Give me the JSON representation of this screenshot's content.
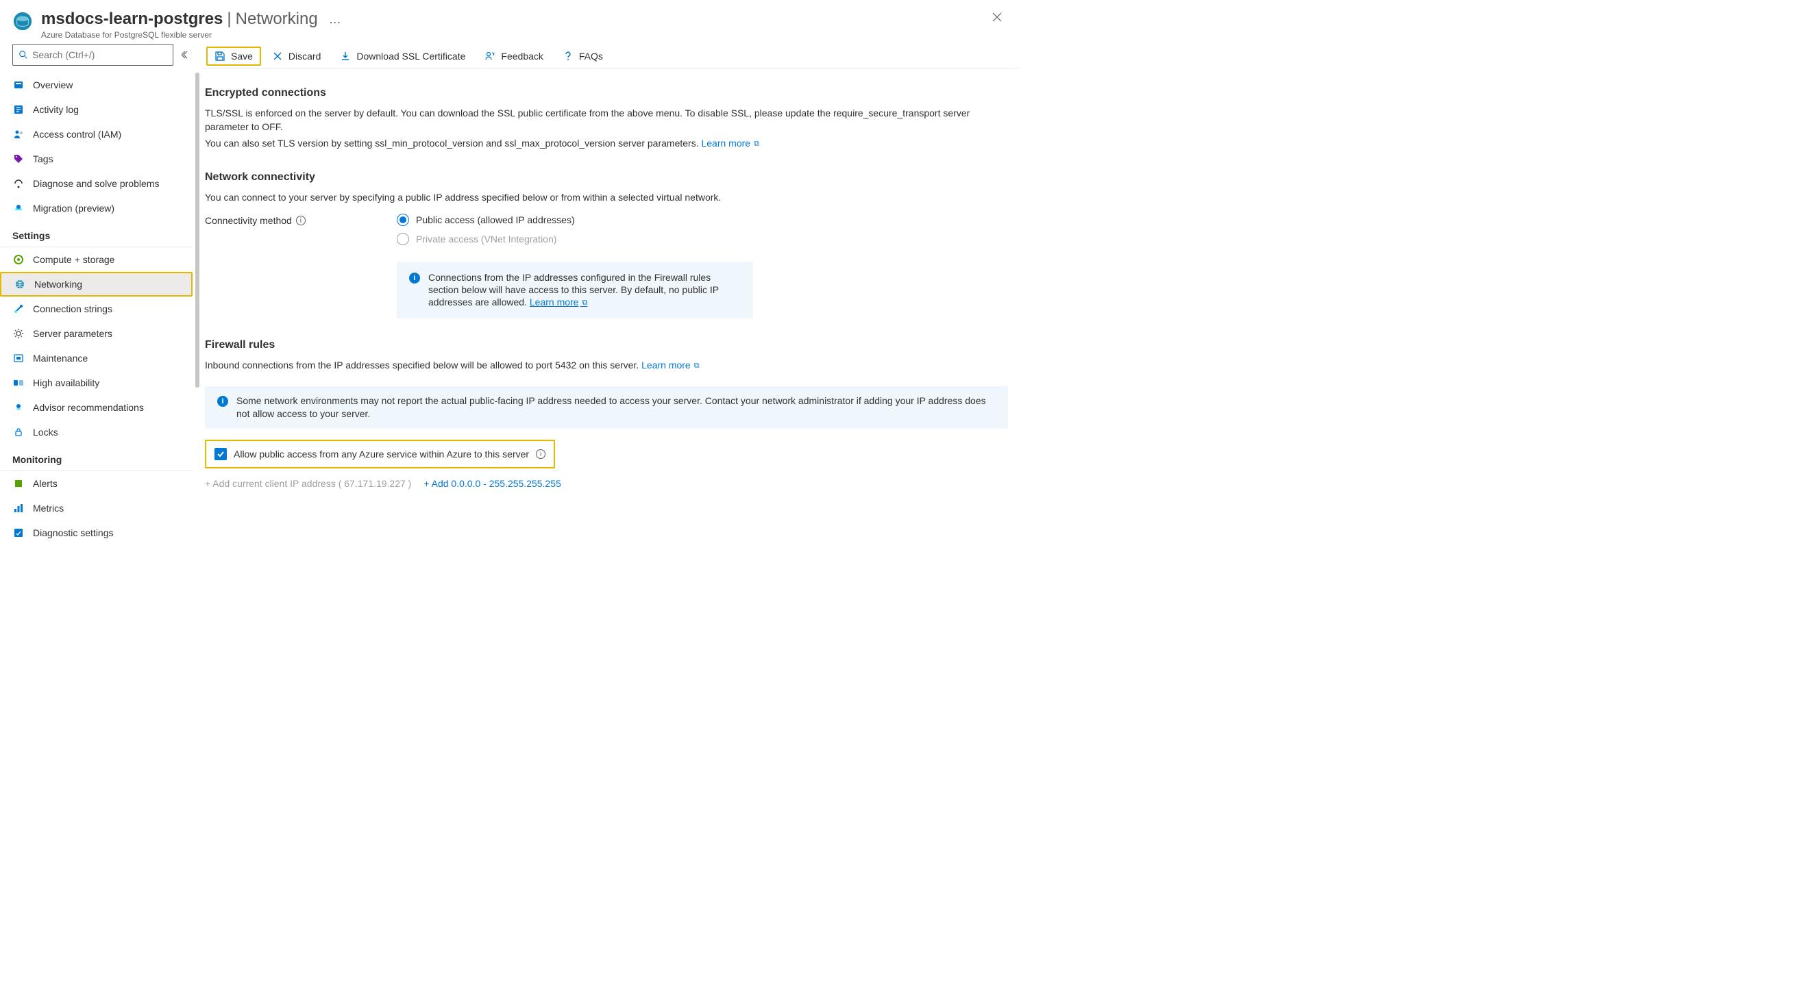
{
  "header": {
    "title": "msdocs-learn-postgres",
    "blade": "Networking",
    "more": "…",
    "subtitle": "Azure Database for PostgreSQL flexible server"
  },
  "search": {
    "placeholder": "Search (Ctrl+/)"
  },
  "sidebar": {
    "top": [
      {
        "label": "Overview"
      },
      {
        "label": "Activity log"
      },
      {
        "label": "Access control (IAM)"
      },
      {
        "label": "Tags"
      },
      {
        "label": "Diagnose and solve problems"
      },
      {
        "label": "Migration (preview)"
      }
    ],
    "settings_header": "Settings",
    "settings": [
      {
        "label": "Compute + storage"
      },
      {
        "label": "Networking"
      },
      {
        "label": "Connection strings"
      },
      {
        "label": "Server parameters"
      },
      {
        "label": "Maintenance"
      },
      {
        "label": "High availability"
      },
      {
        "label": "Advisor recommendations"
      },
      {
        "label": "Locks"
      }
    ],
    "monitoring_header": "Monitoring",
    "monitoring": [
      {
        "label": "Alerts"
      },
      {
        "label": "Metrics"
      },
      {
        "label": "Diagnostic settings"
      }
    ]
  },
  "toolbar": {
    "save": "Save",
    "discard": "Discard",
    "download": "Download SSL Certificate",
    "feedback": "Feedback",
    "faqs": "FAQs"
  },
  "encrypted": {
    "heading": "Encrypted connections",
    "p1": "TLS/SSL is enforced on the server by default. You can download the SSL public certificate from the above menu. To disable SSL, please update the require_secure_transport server parameter to OFF.",
    "p2": "You can also set TLS version by setting ssl_min_protocol_version and ssl_max_protocol_version server parameters.",
    "learn": "Learn more"
  },
  "network": {
    "heading": "Network connectivity",
    "p1": "You can connect to your server by specifying a public IP address specified below or from within a selected virtual network.",
    "label": "Connectivity method",
    "opt1": "Public access (allowed IP addresses)",
    "opt2": "Private access (VNet Integration)",
    "info": "Connections from the IP addresses configured in the Firewall rules section below will have access to this server. By default, no public IP addresses are allowed.",
    "info_learn": "Learn more"
  },
  "firewall": {
    "heading": "Firewall rules",
    "p1": "Inbound connections from the IP addresses specified below will be allowed to port 5432 on this server.",
    "learn": "Learn more",
    "warn": "Some network environments may not report the actual public-facing IP address needed to access your server.  Contact your network administrator if adding your IP address does not allow access to your server.",
    "checkbox_label": "Allow public access from any Azure service within Azure to this server",
    "add_current_prefix": "+ Add current client IP address",
    "add_current_ip": "( 67.171.19.227 )",
    "add_range": "+ Add 0.0.0.0 - 255.255.255.255"
  }
}
